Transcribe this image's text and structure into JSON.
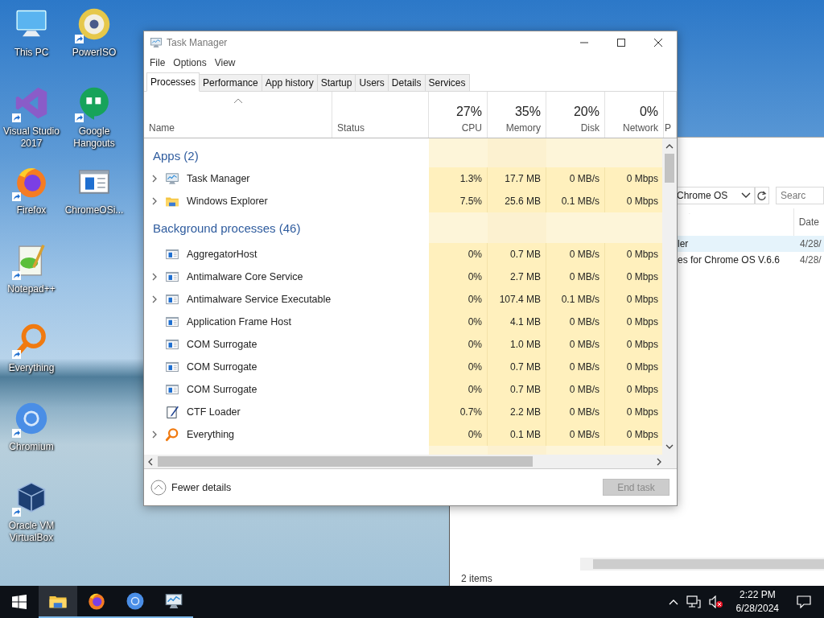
{
  "desktop_icons": [
    {
      "label": "This PC",
      "kind": "computer",
      "shortcut": false
    },
    {
      "label": "Visual Studio 2017",
      "kind": "vs",
      "shortcut": true
    },
    {
      "label": "Firefox",
      "kind": "firefox",
      "shortcut": true
    },
    {
      "label": "Notepad++",
      "kind": "notepadpp",
      "shortcut": true
    },
    {
      "label": "Everything",
      "kind": "everything",
      "shortcut": true
    },
    {
      "label": "Chromium",
      "kind": "chromium",
      "shortcut": true
    },
    {
      "label": "Oracle VM VirtualBox",
      "kind": "virtualbox",
      "shortcut": true
    },
    {
      "label": "PowerISO",
      "kind": "disc",
      "shortcut": true
    },
    {
      "label": "Google Hangouts",
      "kind": "hangouts",
      "shortcut": true
    },
    {
      "label": "ChromeOSi...",
      "kind": "window",
      "shortcut": false
    }
  ],
  "explorer": {
    "location": "Chrome OS",
    "search_placeholder": "Searc",
    "column": "Date",
    "files": [
      {
        "name": "ler",
        "date": "4/28/",
        "selected": true
      },
      {
        "name": "es for Chrome OS V.6.6",
        "date": "4/28/",
        "selected": false
      }
    ],
    "status": "2 items"
  },
  "task_manager": {
    "title": "Task Manager",
    "menu": [
      "File",
      "Options",
      "View"
    ],
    "tabs": [
      {
        "label": "Processes",
        "selected": true
      },
      {
        "label": "Performance",
        "selected": false
      },
      {
        "label": "App history",
        "selected": false
      },
      {
        "label": "Startup",
        "selected": false
      },
      {
        "label": "Users",
        "selected": false
      },
      {
        "label": "Details",
        "selected": false
      },
      {
        "label": "Services",
        "selected": false
      }
    ],
    "columns": [
      {
        "label": "Name",
        "sorted": true
      },
      {
        "label": "Status",
        "sorted": false
      },
      {
        "label": "CPU",
        "usage": "27%",
        "sorted": false
      },
      {
        "label": "Memory",
        "usage": "35%",
        "sorted": false
      },
      {
        "label": "Disk",
        "usage": "20%",
        "sorted": false
      },
      {
        "label": "Network",
        "usage": "0%",
        "sorted": false
      },
      {
        "label": "P",
        "sorted": false
      }
    ],
    "groups": [
      {
        "title": "Apps (2)",
        "rows": [
          {
            "name": "Task Manager",
            "kind": "taskmgr",
            "expandable": true,
            "cpu": "1.3%",
            "memory": "17.7 MB",
            "disk": "0 MB/s",
            "network": "0 Mbps"
          },
          {
            "name": "Windows Explorer",
            "kind": "folder",
            "expandable": true,
            "cpu": "7.5%",
            "memory": "25.6 MB",
            "disk": "0.1 MB/s",
            "network": "0 Mbps"
          }
        ]
      },
      {
        "title": "Background processes (46)",
        "rows": [
          {
            "name": "AggregatorHost",
            "kind": "service",
            "expandable": false,
            "cpu": "0%",
            "memory": "0.7 MB",
            "disk": "0 MB/s",
            "network": "0 Mbps"
          },
          {
            "name": "Antimalware Core Service",
            "kind": "service",
            "expandable": true,
            "cpu": "0%",
            "memory": "2.7 MB",
            "disk": "0 MB/s",
            "network": "0 Mbps"
          },
          {
            "name": "Antimalware Service Executable",
            "kind": "service",
            "expandable": true,
            "cpu": "0%",
            "memory": "107.4 MB",
            "disk": "0.1 MB/s",
            "network": "0 Mbps"
          },
          {
            "name": "Application Frame Host",
            "kind": "service",
            "expandable": false,
            "cpu": "0%",
            "memory": "4.1 MB",
            "disk": "0 MB/s",
            "network": "0 Mbps"
          },
          {
            "name": "COM Surrogate",
            "kind": "service",
            "expandable": false,
            "cpu": "0%",
            "memory": "1.0 MB",
            "disk": "0 MB/s",
            "network": "0 Mbps"
          },
          {
            "name": "COM Surrogate",
            "kind": "service",
            "expandable": false,
            "cpu": "0%",
            "memory": "0.7 MB",
            "disk": "0 MB/s",
            "network": "0 Mbps"
          },
          {
            "name": "COM Surrogate",
            "kind": "service",
            "expandable": false,
            "cpu": "0%",
            "memory": "0.7 MB",
            "disk": "0 MB/s",
            "network": "0 Mbps"
          },
          {
            "name": "CTF Loader",
            "kind": "ctf",
            "expandable": false,
            "cpu": "0.7%",
            "memory": "2.2 MB",
            "disk": "0 MB/s",
            "network": "0 Mbps"
          },
          {
            "name": "Everything",
            "kind": "everything",
            "expandable": true,
            "cpu": "0%",
            "memory": "0.1 MB",
            "disk": "0 MB/s",
            "network": "0 Mbps"
          }
        ]
      }
    ],
    "fewer_details": "Fewer details",
    "end_task": {
      "label": "End task",
      "disabled": true
    }
  },
  "taskbar": {
    "apps": [
      {
        "kind": "folder",
        "active": true
      },
      {
        "kind": "firefox",
        "active": false
      },
      {
        "kind": "chromium",
        "active": false
      },
      {
        "kind": "taskmgr",
        "active": false
      }
    ],
    "time": "2:22 PM",
    "date": "6/28/2024"
  }
}
